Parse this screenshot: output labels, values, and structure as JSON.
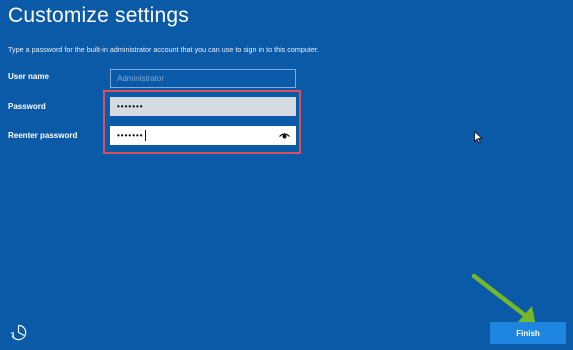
{
  "page": {
    "title": "Customize settings",
    "description": "Type a password for the built-in administrator account that you can use to sign in to this computer."
  },
  "form": {
    "username": {
      "label": "User name",
      "placeholder": "Administrator"
    },
    "password": {
      "label": "Password",
      "masked_value": "•••••••"
    },
    "reenter_password": {
      "label": "Reenter password",
      "masked_value": "•••••••",
      "reveal_icon": "eye-icon"
    }
  },
  "footer": {
    "accessibility_icon": "ease-of-access-icon",
    "finish_label": "Finish"
  },
  "colors": {
    "background": "#0b5aa8",
    "finish_button": "#1e86e0",
    "highlight_border": "#d8505b",
    "annotation_arrow": "#74b82a"
  }
}
